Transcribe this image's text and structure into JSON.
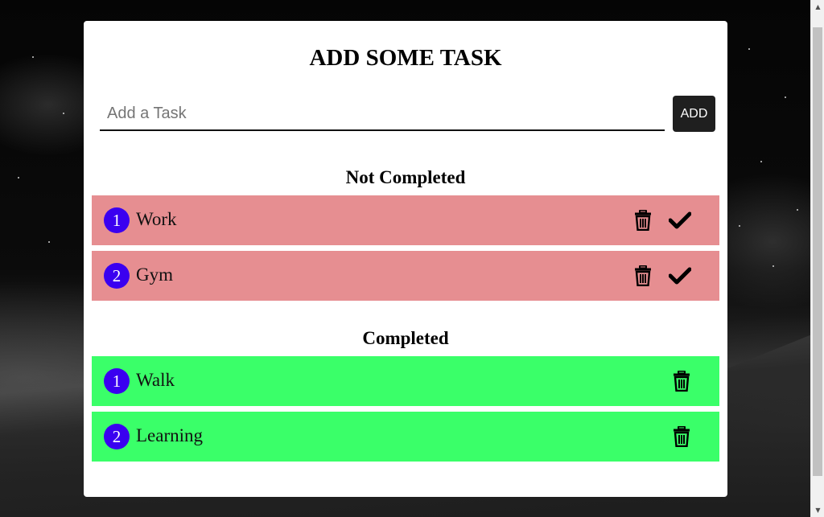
{
  "page": {
    "title": "ADD SOME TASK",
    "input_placeholder": "Add a Task",
    "add_label": "ADD"
  },
  "sections": {
    "not_completed": {
      "title": "Not Completed",
      "tasks": [
        {
          "number": "1",
          "label": "Work"
        },
        {
          "number": "2",
          "label": "Gym"
        }
      ]
    },
    "completed": {
      "title": "Completed",
      "tasks": [
        {
          "number": "1",
          "label": "Walk"
        },
        {
          "number": "2",
          "label": "Learning"
        }
      ]
    }
  },
  "icons": {
    "delete": "trash-icon",
    "complete": "checkmark-icon"
  },
  "colors": {
    "pending_row": "#e68e91",
    "completed_row": "#3aff69",
    "number_badge": "#3a00f0",
    "add_button": "#1f1f1f"
  }
}
